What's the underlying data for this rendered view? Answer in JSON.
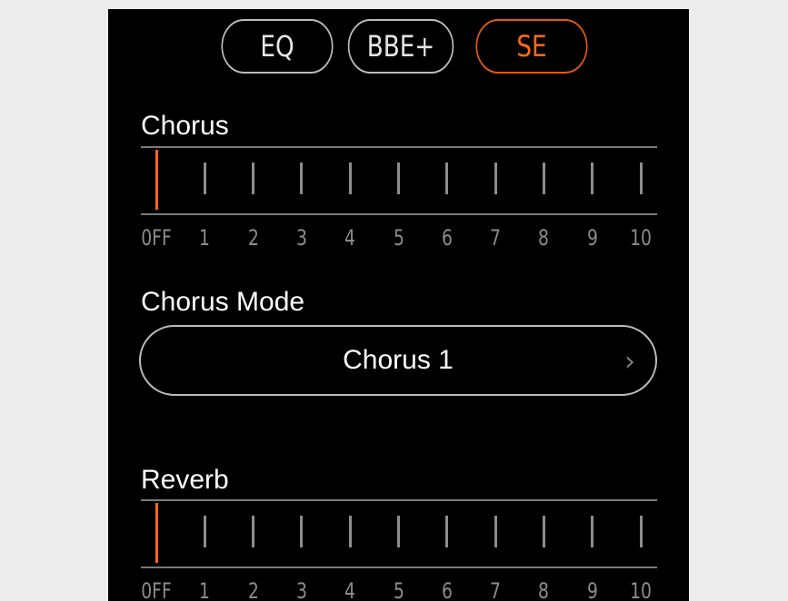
{
  "tabs": [
    {
      "label": "EQ",
      "active": false
    },
    {
      "label": "BBE+",
      "active": false
    },
    {
      "label": "SE",
      "active": true
    }
  ],
  "chorus": {
    "title": "Chorus",
    "value": "0FF",
    "scale_labels": [
      "0FF",
      "1",
      "2",
      "3",
      "4",
      "5",
      "6",
      "7",
      "8",
      "9",
      "10"
    ]
  },
  "chorus_mode": {
    "title": "Chorus Mode",
    "value": "Chorus 1",
    "chevron": "chevron-right-icon"
  },
  "reverb": {
    "title": "Reverb",
    "value": "0FF",
    "scale_labels": [
      "0FF",
      "1",
      "2",
      "3",
      "4",
      "5",
      "6",
      "7",
      "8",
      "9",
      "10"
    ]
  },
  "colors": {
    "accent": "#ff6a16",
    "background": "#000000",
    "outer": "#ececec"
  }
}
